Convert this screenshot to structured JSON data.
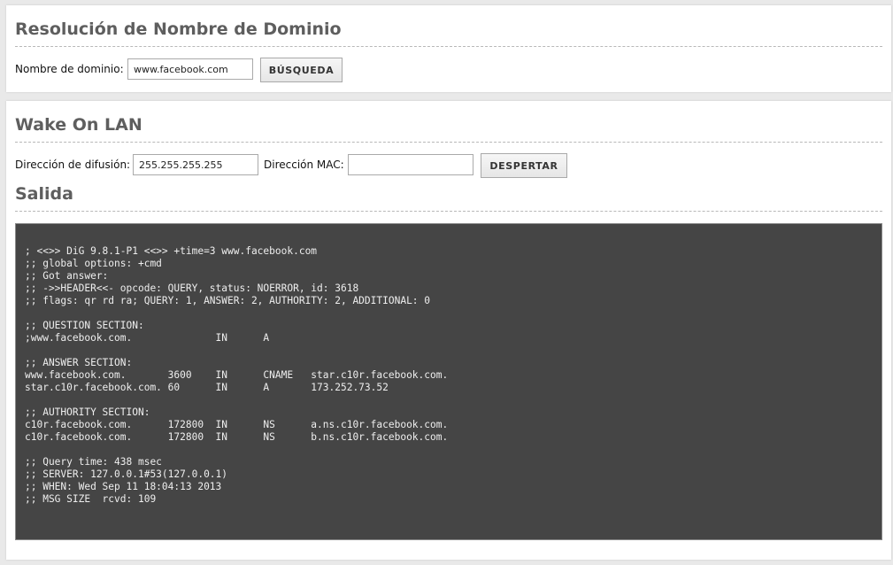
{
  "dns": {
    "title": "Resolución de Nombre de Dominio",
    "domain_label": "Nombre de dominio:",
    "domain_value": "www.facebook.com",
    "search_button": "BÚSQUEDA"
  },
  "wol": {
    "title": "Wake On LAN",
    "broadcast_label": "Dirección de difusión:",
    "broadcast_value": "255.255.255.255",
    "mac_label": "Dirección MAC:",
    "mac_value": "",
    "wake_button": "DESPERTAR"
  },
  "output": {
    "title": "Salida",
    "text": "; <<>> DiG 9.8.1-P1 <<>> +time=3 www.facebook.com\n;; global options: +cmd\n;; Got answer:\n;; ->>HEADER<<- opcode: QUERY, status: NOERROR, id: 3618\n;; flags: qr rd ra; QUERY: 1, ANSWER: 2, AUTHORITY: 2, ADDITIONAL: 0\n\n;; QUESTION SECTION:\n;www.facebook.com.              IN      A\n\n;; ANSWER SECTION:\nwww.facebook.com.       3600    IN      CNAME   star.c10r.facebook.com.\nstar.c10r.facebook.com. 60      IN      A       173.252.73.52\n\n;; AUTHORITY SECTION:\nc10r.facebook.com.      172800  IN      NS      a.ns.c10r.facebook.com.\nc10r.facebook.com.      172800  IN      NS      b.ns.c10r.facebook.com.\n\n;; Query time: 438 msec\n;; SERVER: 127.0.0.1#53(127.0.0.1)\n;; WHEN: Wed Sep 11 18:04:13 2013\n;; MSG SIZE  rcvd: 109"
  },
  "colors": {
    "page_background": "#e9e9e9",
    "panel_background": "#ffffff",
    "title_color": "#5e5e5e",
    "output_background": "#454545",
    "output_text": "#eeeeee"
  }
}
